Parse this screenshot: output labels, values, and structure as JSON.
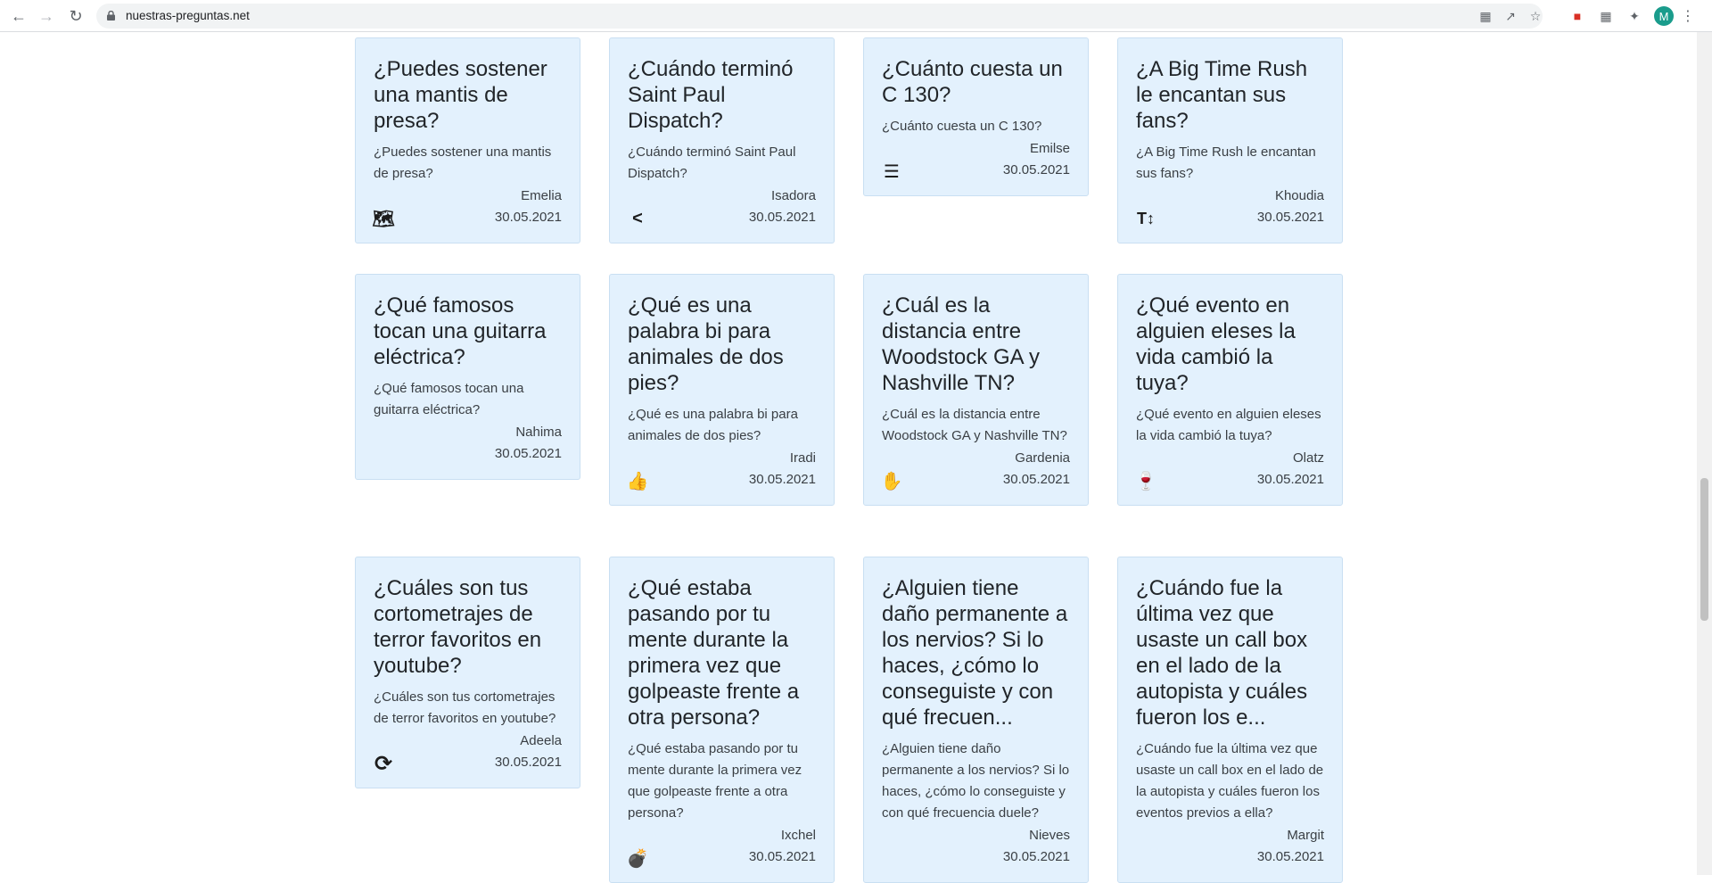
{
  "browser": {
    "url": "nuestras-preguntas.net",
    "profile_initial": "M"
  },
  "cards": [
    {
      "title": "¿Puedes sostener una mantis de presa?",
      "excerpt": "¿Puedes sostener una mantis de presa?",
      "author": "Emelia",
      "date": "30.05.2021",
      "icon": "map-icon",
      "glyph": "🗺"
    },
    {
      "title": "¿Cuándo terminó Saint Paul Dispatch?",
      "excerpt": "¿Cuándo terminó Saint Paul Dispatch?",
      "author": "Isadora",
      "date": "30.05.2021",
      "icon": "less-than-icon",
      "glyph": "<"
    },
    {
      "title": "¿Cuánto cuesta un C 130?",
      "excerpt": "¿Cuánto cuesta un C 130?",
      "author": "Emilse",
      "date": "30.05.2021",
      "icon": "list-icon",
      "glyph": "☰"
    },
    {
      "title": "¿A Big Time Rush le encantan sus fans?",
      "excerpt": "¿A Big Time Rush le encantan sus fans?",
      "author": "Khoudia",
      "date": "30.05.2021",
      "icon": "text-height-icon",
      "glyph": "T↕"
    },
    {
      "title": "¿Qué famosos tocan una guitarra eléctrica?",
      "excerpt": "¿Qué famosos tocan una guitarra eléctrica?",
      "author": "Nahima",
      "date": "30.05.2021",
      "icon": "",
      "glyph": ""
    },
    {
      "title": "¿Qué es una palabra bi para animales de dos pies?",
      "excerpt": "¿Qué es una palabra bi para animales de dos pies?",
      "author": "Iradi",
      "date": "30.05.2021",
      "icon": "thumbs-up-icon",
      "glyph": "👍"
    },
    {
      "title": "¿Cuál es la distancia entre Woodstock GA y Nashville TN?",
      "excerpt": "¿Cuál es la distancia entre Woodstock GA y Nashville TN?",
      "author": "Gardenia",
      "date": "30.05.2021",
      "icon": "hand-icon",
      "glyph": "✋"
    },
    {
      "title": "¿Qué evento en alguien eleses la vida cambió la tuya?",
      "excerpt": "¿Qué evento en alguien eleses la vida cambió la tuya?",
      "author": "Olatz",
      "date": "30.05.2021",
      "icon": "wine-glass-icon",
      "glyph": "🍷"
    },
    {
      "title": "¿Cuáles son tus cortometrajes de terror favoritos en youtube?",
      "excerpt": "¿Cuáles son tus cortometrajes de terror favoritos en youtube?",
      "author": "Adeela",
      "date": "30.05.2021",
      "icon": "sync-icon",
      "glyph": "⟳"
    },
    {
      "title": "¿Qué estaba pasando por tu mente durante la primera vez que golpeaste frente a otra persona?",
      "excerpt": "¿Qué estaba pasando por tu mente durante la primera vez que golpeaste frente a otra persona?",
      "author": "Ixchel",
      "date": "30.05.2021",
      "icon": "bomb-icon",
      "glyph": "💣"
    },
    {
      "title": "¿Alguien tiene daño permanente a los nervios? Si lo haces, ¿cómo lo conseguiste y con qué frecuen...",
      "excerpt": "¿Alguien tiene daño permanente a los nervios? Si lo haces, ¿cómo lo conseguiste y con qué frecuencia duele?",
      "author": "Nieves",
      "date": "30.05.2021",
      "icon": "",
      "glyph": ""
    },
    {
      "title": "¿Cuándo fue la última vez que usaste un call box en el lado de la autopista y cuáles fueron los e...",
      "excerpt": "¿Cuándo fue la última vez que usaste un call box en el lado de la autopista y cuáles fueron los eventos previos a ella?",
      "author": "Margit",
      "date": "30.05.2021",
      "icon": "",
      "glyph": ""
    }
  ]
}
